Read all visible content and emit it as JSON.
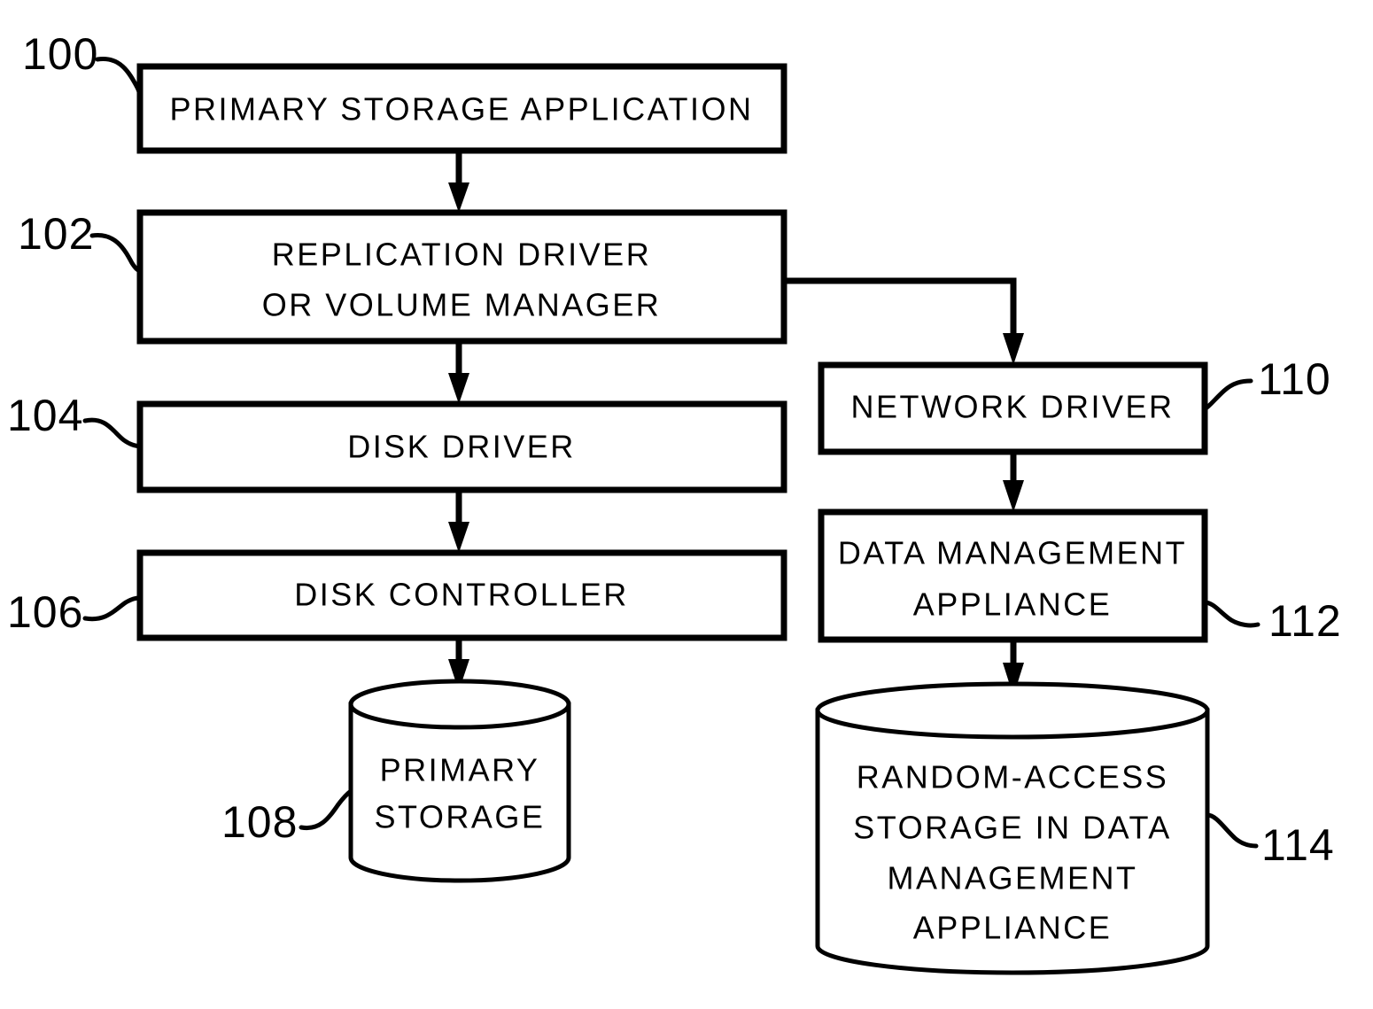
{
  "figure": {
    "type": "block-diagram",
    "background_color": "#ffffff",
    "line_color": "#000000",
    "nodes": [
      {
        "id": "n100",
        "ref": "100",
        "shape": "rectangle",
        "lines": [
          "PRIMARY  STORAGE  APPLICATION"
        ]
      },
      {
        "id": "n102",
        "ref": "102",
        "shape": "rectangle",
        "lines": [
          "REPLICATION  DRIVER",
          "OR  VOLUME  MANAGER"
        ]
      },
      {
        "id": "n104",
        "ref": "104",
        "shape": "rectangle",
        "lines": [
          "DISK  DRIVER"
        ]
      },
      {
        "id": "n106",
        "ref": "106",
        "shape": "rectangle",
        "lines": [
          "DISK  CONTROLLER"
        ]
      },
      {
        "id": "n108",
        "ref": "108",
        "shape": "cylinder",
        "lines": [
          "PRIMARY",
          "STORAGE"
        ]
      },
      {
        "id": "n110",
        "ref": "110",
        "shape": "rectangle",
        "lines": [
          "NETWORK  DRIVER"
        ]
      },
      {
        "id": "n112",
        "ref": "112",
        "shape": "rectangle",
        "lines": [
          "DATA  MANAGEMENT",
          "APPLIANCE"
        ]
      },
      {
        "id": "n114",
        "ref": "114",
        "shape": "cylinder",
        "lines": [
          "RANDOM-ACCESS",
          "STORAGE  IN  DATA",
          "MANAGEMENT",
          "APPLIANCE"
        ]
      }
    ],
    "ref_numbers": {
      "n100": "100",
      "n102": "102",
      "n104": "104",
      "n106": "106",
      "n108": "108",
      "n110": "110",
      "n112": "112",
      "n114": "114"
    },
    "node_text": {
      "n100_l0": "PRIMARY  STORAGE  APPLICATION",
      "n102_l0": "REPLICATION  DRIVER",
      "n102_l1": "OR  VOLUME  MANAGER",
      "n104_l0": "DISK  DRIVER",
      "n106_l0": "DISK  CONTROLLER",
      "n108_l0": "PRIMARY",
      "n108_l1": "STORAGE",
      "n110_l0": "NETWORK  DRIVER",
      "n112_l0": "DATA  MANAGEMENT",
      "n112_l1": "APPLIANCE",
      "n114_l0": "RANDOM-ACCESS",
      "n114_l1": "STORAGE  IN  DATA",
      "n114_l2": "MANAGEMENT",
      "n114_l3": "APPLIANCE"
    },
    "edges": [
      {
        "from": "n100",
        "to": "n102",
        "style": "arrow-down"
      },
      {
        "from": "n102",
        "to": "n104",
        "style": "arrow-down"
      },
      {
        "from": "n104",
        "to": "n106",
        "style": "arrow-down"
      },
      {
        "from": "n106",
        "to": "n108",
        "style": "arrow-down"
      },
      {
        "from": "n102",
        "to": "n110",
        "style": "elbow-right-down-arrow"
      },
      {
        "from": "n110",
        "to": "n112",
        "style": "arrow-down"
      },
      {
        "from": "n112",
        "to": "n114",
        "style": "arrow-down"
      }
    ]
  }
}
